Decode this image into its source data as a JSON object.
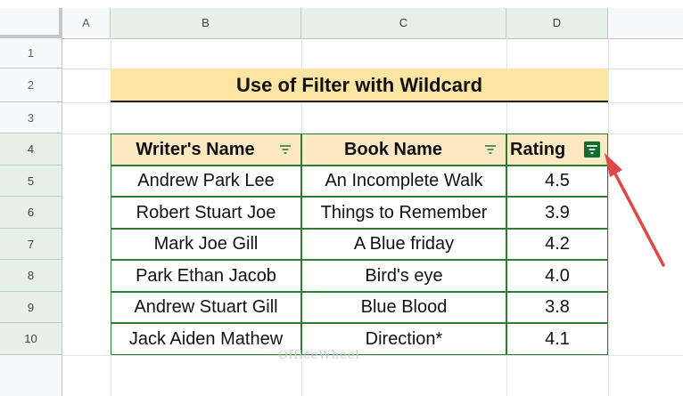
{
  "columns": [
    "A",
    "B",
    "C",
    "D"
  ],
  "rows": [
    "1",
    "2",
    "3",
    "4",
    "5",
    "6",
    "7",
    "8",
    "9",
    "10"
  ],
  "title": "Use of Filter with Wildcard",
  "table": {
    "headers": [
      "Writer's Name",
      "Book Name",
      "Rating"
    ],
    "rows": [
      [
        "Andrew Park Lee",
        "An Incomplete Walk",
        "4.5"
      ],
      [
        "Robert Stuart Joe",
        "Things to Remember",
        "3.9"
      ],
      [
        "Mark Joe Gill",
        "A Blue friday",
        "4.2"
      ],
      [
        "Park Ethan Jacob",
        "Bird's eye",
        "4.0"
      ],
      [
        "Andrew Stuart Gill",
        "Blue Blood",
        "3.8"
      ],
      [
        "Jack Aiden Mathew",
        "Direction*",
        "4.1"
      ]
    ]
  },
  "watermark": "OfficeWheel",
  "colors": {
    "title_bg": "#fce4a2",
    "header_bg": "#fce8c3",
    "border": "#2e7d32",
    "filter_active": "#146b2e",
    "arrow": "#e04848"
  }
}
